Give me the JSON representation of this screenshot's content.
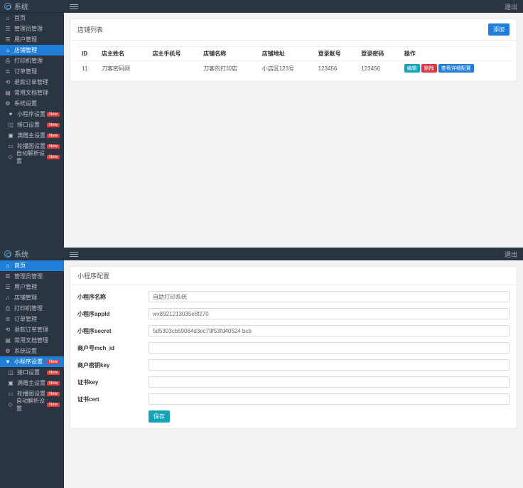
{
  "brand": "系统",
  "logout_label": "退出",
  "panel1": {
    "menu": [
      {
        "label": "首页",
        "icon": "home",
        "badge": null,
        "active": false
      },
      {
        "label": "管理员管理",
        "icon": "users",
        "badge": null,
        "active": false
      },
      {
        "label": "用户管理",
        "icon": "users",
        "badge": null,
        "active": false
      },
      {
        "label": "店铺管理",
        "icon": "shop",
        "badge": null,
        "active": true
      },
      {
        "label": "打印机管理",
        "icon": "print",
        "badge": null,
        "active": false
      },
      {
        "label": "订单管理",
        "icon": "order",
        "badge": null,
        "active": false
      },
      {
        "label": "退款订单管理",
        "icon": "refund",
        "badge": null,
        "active": false
      },
      {
        "label": "常用文档管理",
        "icon": "doc",
        "badge": null,
        "active": false
      },
      {
        "label": "系统设置",
        "icon": "cog",
        "badge": null,
        "active": false
      },
      {
        "label": "小程序设置",
        "icon": "heart",
        "badge": "New",
        "active": false,
        "indent": true
      },
      {
        "label": "接口设置",
        "icon": "api",
        "badge": "New",
        "active": false,
        "indent": true
      },
      {
        "label": "满赠主设置",
        "icon": "gift",
        "badge": "New",
        "active": false,
        "indent": true
      },
      {
        "label": "轮播图设置",
        "icon": "img",
        "badge": "New",
        "active": false,
        "indent": true
      },
      {
        "label": "自动解析设置",
        "icon": "auto",
        "badge": "New",
        "active": false,
        "indent": true
      }
    ],
    "card_title": "店铺列表",
    "add_label": "添加",
    "table": {
      "headers": [
        "ID",
        "店主姓名",
        "店主手机号",
        "店铺名称",
        "店铺地址",
        "登录账号",
        "登录密码",
        "操作"
      ],
      "rows": [
        {
          "id": "11",
          "owner": "刀客密码网",
          "phone": "",
          "shop_name": "刀客的打印店",
          "address": "小店区123号",
          "account": "123456",
          "password": "123456"
        }
      ],
      "row_actions": {
        "edit": "编辑",
        "del": "删除",
        "detail": "查看详细配置"
      }
    }
  },
  "panel2": {
    "menu": [
      {
        "label": "首页",
        "icon": "home",
        "badge": null,
        "active": true
      },
      {
        "label": "管理员管理",
        "icon": "users",
        "badge": null,
        "active": false
      },
      {
        "label": "用户管理",
        "icon": "users",
        "badge": null,
        "active": false
      },
      {
        "label": "店铺管理",
        "icon": "shop",
        "badge": null,
        "active": false
      },
      {
        "label": "打印机管理",
        "icon": "print",
        "badge": null,
        "active": false
      },
      {
        "label": "订单管理",
        "icon": "order",
        "badge": null,
        "active": false
      },
      {
        "label": "退款订单管理",
        "icon": "refund",
        "badge": null,
        "active": false
      },
      {
        "label": "常用文档管理",
        "icon": "doc",
        "badge": null,
        "active": false
      },
      {
        "label": "系统设置",
        "icon": "cog",
        "badge": null,
        "active": false
      },
      {
        "label": "小程序设置",
        "icon": "heart",
        "badge": "New",
        "active": true,
        "highlight": true
      },
      {
        "label": "接口设置",
        "icon": "api",
        "badge": "New",
        "active": false,
        "indent": true
      },
      {
        "label": "满赠主设置",
        "icon": "gift",
        "badge": "New",
        "active": false,
        "indent": true
      },
      {
        "label": "轮播图设置",
        "icon": "img",
        "badge": "New",
        "active": false,
        "indent": true
      },
      {
        "label": "自动解析设置",
        "icon": "auto",
        "badge": "New",
        "active": false,
        "indent": true
      }
    ],
    "card_title": "小程序配置",
    "form": {
      "fields": [
        {
          "label": "小程序名称",
          "value": "自助打印系统",
          "name": "mp-name"
        },
        {
          "label": "小程序appId",
          "value": "wx8921213035e8f270",
          "name": "mp-appid"
        },
        {
          "label": "小程序secret",
          "value": "5d5303cb59064d3ec79f53fd40524 bcb",
          "name": "mp-secret"
        },
        {
          "label": "商户号mch_id",
          "value": "",
          "name": "mch-id"
        },
        {
          "label": "商户密钥key",
          "value": "",
          "name": "mch-key"
        },
        {
          "label": "证书key",
          "value": "",
          "name": "cert-key"
        },
        {
          "label": "证书cert",
          "value": "",
          "name": "cert-cert"
        }
      ],
      "submit": "保存"
    }
  },
  "icons": {
    "home": "⌂",
    "users": "☰",
    "shop": "⌂",
    "print": "⎙",
    "order": "≣",
    "refund": "⟲",
    "doc": "▤",
    "cog": "⚙",
    "heart": "♥",
    "api": "◫",
    "gift": "▣",
    "img": "▭",
    "auto": "◇"
  }
}
